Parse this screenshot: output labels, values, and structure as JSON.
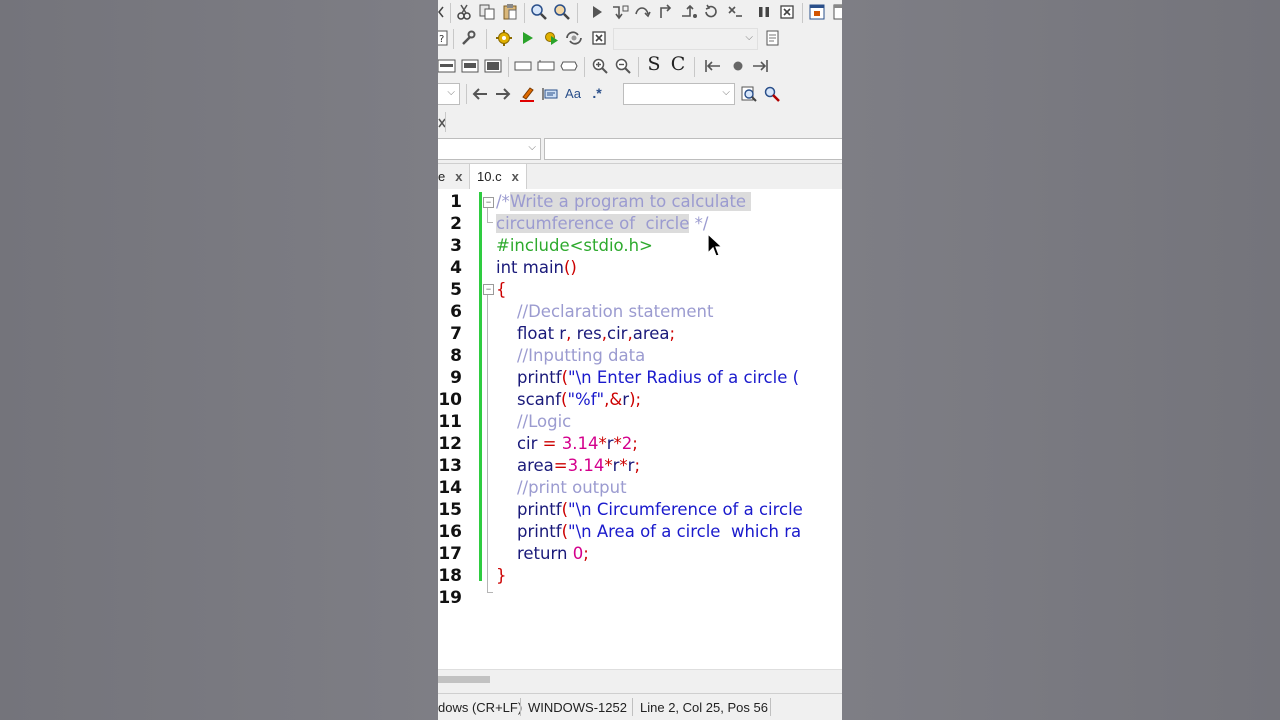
{
  "tabs": [
    {
      "label": "e",
      "close": "x"
    },
    {
      "label": "10.c",
      "close": "x"
    }
  ],
  "toolbar": {
    "s_label": "S",
    "c_label": "C",
    "aa_label": "Aa",
    "regex_label": ".*"
  },
  "editor": {
    "line_numbers": [
      "1",
      "2",
      "3",
      "4",
      "5",
      "6",
      "7",
      "8",
      "9",
      "10",
      "11",
      "12",
      "13",
      "14",
      "15",
      "16",
      "17",
      "18",
      "19"
    ]
  },
  "status": {
    "eol": "dows (CR+LF)",
    "encoding": "WINDOWS-1252",
    "position": "Line 2, Col 25, Pos 56"
  },
  "colors": {
    "comment": "#9b9bd0",
    "preprocessor": "#2eaa2e",
    "keyword": "#1a1a7a",
    "operator": "#cc0000",
    "number": "#d4008c",
    "string": "#1a1acc",
    "modified_bar": "#2ecc40"
  },
  "cursor": "mouse-pointer-icon"
}
